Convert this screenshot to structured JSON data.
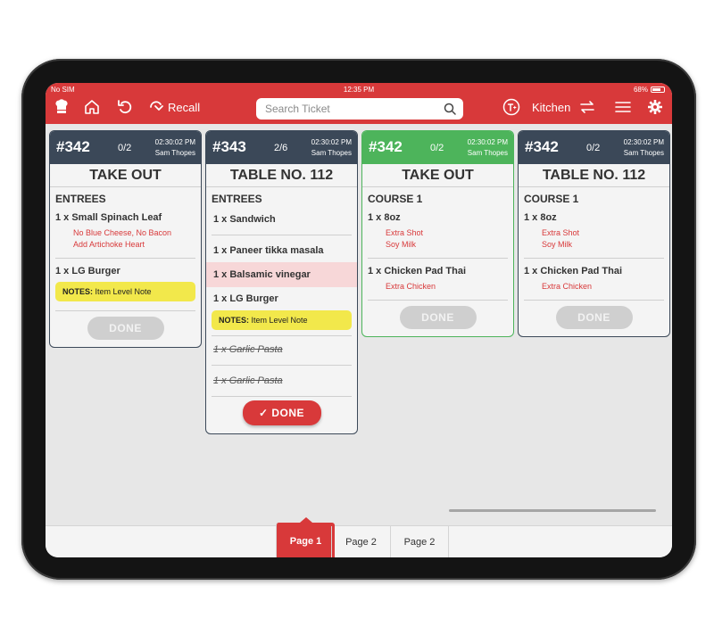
{
  "status_bar": {
    "carrier": "No SIM",
    "time": "12:35 PM",
    "battery": "68%"
  },
  "header": {
    "recall_label": "Recall",
    "search_placeholder": "Search Ticket",
    "station_label": "Kitchen",
    "accent_color": "#d8393a"
  },
  "tickets": [
    {
      "number": "#342",
      "count": "0/2",
      "time": "02:30:02 PM",
      "user": "Sam Thopes",
      "type": "TAKE OUT",
      "section": "ENTREES",
      "items": [
        {
          "label": "1 x  Small Spinach Leaf",
          "mods": [
            "No Blue Cheese, No Bacon",
            "Add Artichoke Heart"
          ]
        },
        {
          "label": "1 x  LG  Burger"
        }
      ],
      "notes_label": "NOTES:",
      "notes_text": "Item Level Note",
      "done_label": "DONE"
    },
    {
      "number": "#343",
      "count": "2/6",
      "time": "02:30:02 PM",
      "user": "Sam Thopes",
      "type": "TABLE NO. 112",
      "section": "ENTREES",
      "items": [
        {
          "label": "1 x  Sandwich"
        },
        {
          "label": "1 x  Paneer tikka masala"
        },
        {
          "label": "1 x  Balsamic vinegar"
        },
        {
          "label": "1 x  LG  Burger"
        },
        {
          "label": "1 x  Garlic Pasta"
        },
        {
          "label": "1 x  Garlic Pasta"
        }
      ],
      "notes_label": "NOTES:",
      "notes_text": "Item Level Note",
      "done_label": "DONE"
    },
    {
      "number": "#342",
      "count": "0/2",
      "time": "02:30:02 PM",
      "user": "Sam Thopes",
      "type": "TAKE OUT",
      "section": "COURSE 1",
      "items": [
        {
          "label": "1 x  8oz",
          "mods": [
            "Extra Shot",
            "Soy Milk"
          ]
        },
        {
          "label": "1 x  Chicken Pad Thai",
          "mods": [
            "Extra Chicken"
          ]
        }
      ],
      "done_label": "DONE"
    },
    {
      "number": "#342",
      "count": "0/2",
      "time": "02:30:02 PM",
      "user": "Sam Thopes",
      "type": "TABLE NO. 112",
      "section": "COURSE 1",
      "items": [
        {
          "label": "1 x  8oz",
          "mods": [
            "Extra Shot",
            "Soy Milk"
          ]
        },
        {
          "label": "1 x  Chicken Pad Thai",
          "mods": [
            "Extra Chicken"
          ]
        }
      ],
      "done_label": "DONE"
    }
  ],
  "pager": {
    "tabs": [
      "Page 1",
      "Page 2",
      "Page 2"
    ],
    "active": "Page 1"
  }
}
